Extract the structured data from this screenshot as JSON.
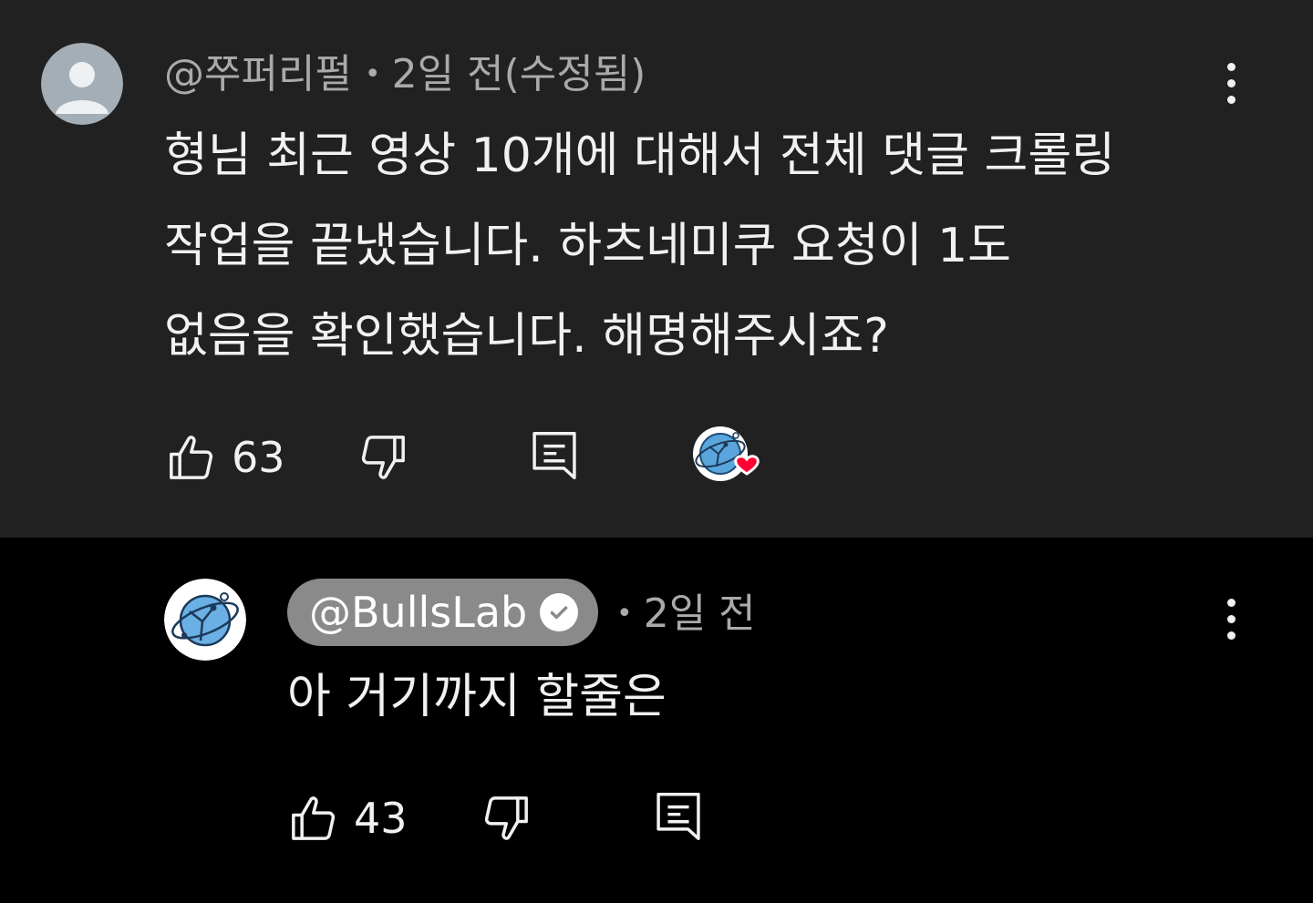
{
  "comments": [
    {
      "author": "@쭈퍼리펄",
      "time": "2일 전(수정됨)",
      "separator": "•",
      "text_lines": [
        "형님 최근 영상 10개에 대해서 전체 댓글 크롤링",
        "작업을 끝냈습니다. 하츠네미쿠 요청이 1도",
        "없음을 확인했습니다. 해명해주시죠?"
      ],
      "likes": "63",
      "avatar_icon": "default-user-avatar-icon",
      "creator_heart": true
    }
  ],
  "reply": {
    "author": "@BullsLab",
    "verified": true,
    "separator": "•",
    "time": "2일 전",
    "text": "아 거기까지 할줄은",
    "likes": "43",
    "avatar_icon": "bullslab-globe-logo-icon"
  },
  "colors": {
    "comment_bg": "#212121",
    "reply_bg": "#000000",
    "text_primary": "#f1f1f1",
    "text_secondary": "#aaaaaa",
    "channel_pill": "#8a8a8a",
    "heart": "#ff0033"
  },
  "icons": {
    "like": "thumbs-up-icon",
    "dislike": "thumbs-down-icon",
    "reply": "reply-comment-icon",
    "more": "more-vertical-icon",
    "verified": "verified-check-icon",
    "heart": "creator-heart-icon"
  }
}
